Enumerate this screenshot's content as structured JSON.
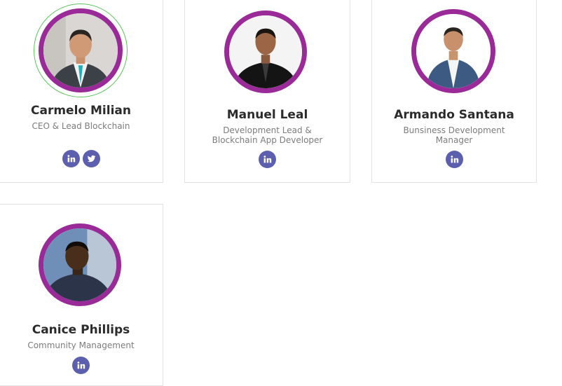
{
  "team": [
    {
      "name": "Carmelo Milian",
      "role": "CEO & Lead Blockchain",
      "socials": [
        "linkedin-icon",
        "twitter-icon"
      ],
      "photo": "portrait-man-suit-teal-tie"
    },
    {
      "name": "Manuel Leal",
      "role": "Development Lead & Blockchain App Developer",
      "socials": [
        "linkedin-icon"
      ],
      "photo": "portrait-man-black-shirt"
    },
    {
      "name": "Armando Santana",
      "role": "Bunsiness Development Manager",
      "socials": [
        "linkedin-icon"
      ],
      "photo": "portrait-man-blue-suit"
    },
    {
      "name": "Canice Phillips",
      "role": "Community Management",
      "socials": [
        "linkedin-icon"
      ],
      "photo": "portrait-young-man-selfie"
    }
  ],
  "colors": {
    "ring": "#9a2a98",
    "hover_ring": "#5cc35a",
    "social_bg": "#5b5fae",
    "name": "#2b2b2b",
    "role": "#7c7c7c",
    "card_border": "#e3e3e3"
  }
}
